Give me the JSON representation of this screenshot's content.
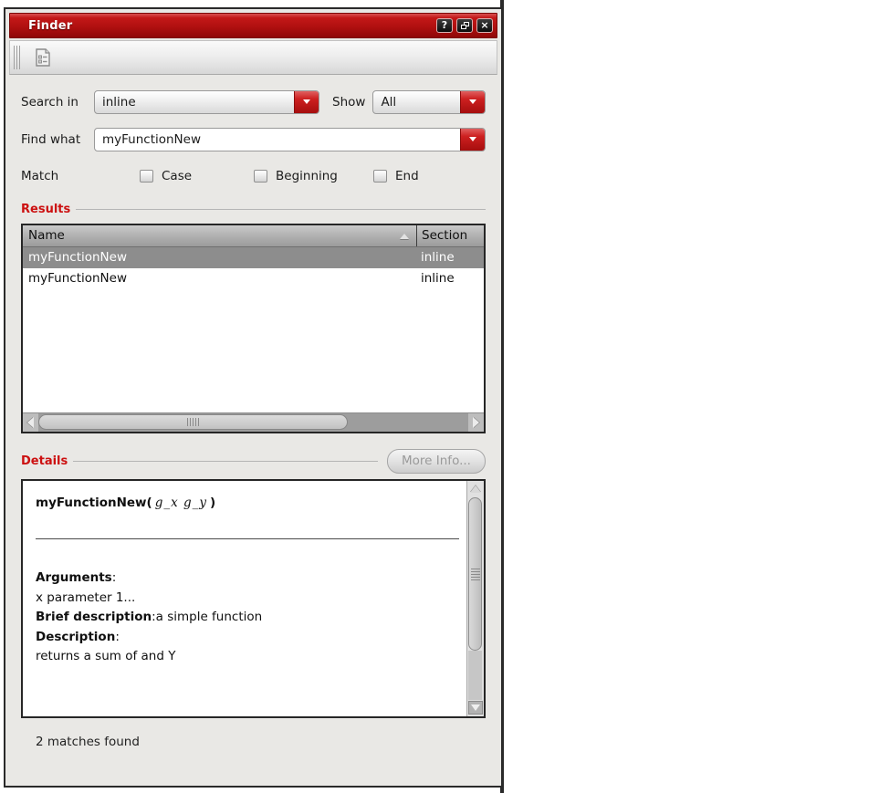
{
  "window": {
    "title": "Finder"
  },
  "titlebar": {
    "help_glyph": "?",
    "close_glyph": "×"
  },
  "search": {
    "search_in_label": "Search in",
    "search_in_value": "inline",
    "show_label": "Show",
    "show_value": "All",
    "find_what_label": "Find what",
    "find_what_value": "myFunctionNew"
  },
  "match": {
    "label": "Match",
    "options": [
      {
        "label": "Case",
        "checked": false
      },
      {
        "label": "Beginning",
        "checked": false
      },
      {
        "label": "End",
        "checked": false
      }
    ]
  },
  "results": {
    "section_label": "Results",
    "columns": [
      "Name",
      "Section"
    ],
    "rows": [
      {
        "name": "myFunctionNew",
        "section": "inline",
        "selected": true
      },
      {
        "name": "myFunctionNew",
        "section": "inline",
        "selected": false
      }
    ]
  },
  "details": {
    "section_label": "Details",
    "more_info_label": "More Info...",
    "signature": {
      "name": "myFunctionNew(",
      "params": "g_x g_y",
      "close": ")"
    },
    "lines": [
      {
        "bold": "Arguments",
        "rest": ":"
      },
      {
        "bold": "",
        "rest": "x parameter 1..."
      },
      {
        "bold": "Brief description",
        "rest": ":a simple function"
      },
      {
        "bold": "Description",
        "rest": ":"
      },
      {
        "bold": "",
        "rest": "returns a sum of and Y"
      }
    ]
  },
  "status": {
    "text": "2 matches found"
  },
  "colors": {
    "titlebar_red": "#b01010",
    "accent_red": "#cc1111",
    "selected_row_gray": "#8d8d8d"
  }
}
